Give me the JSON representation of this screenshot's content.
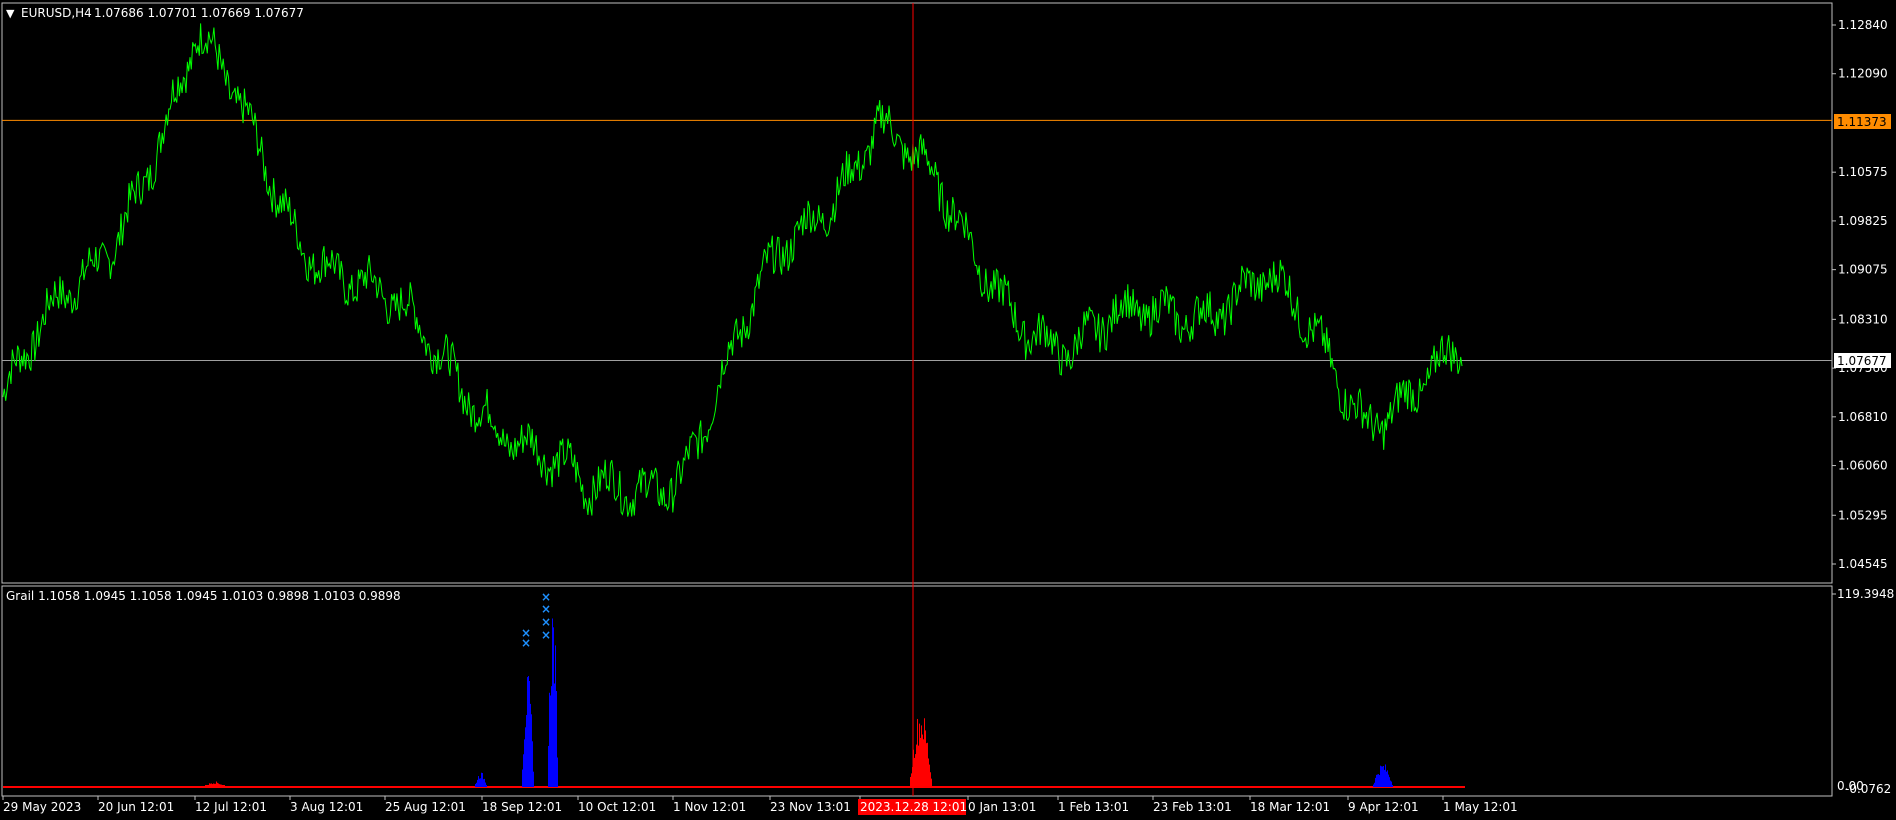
{
  "window": {
    "symbol_label": "EURUSD,H4",
    "ohlc": "1.07686 1.07701 1.07669 1.07677"
  },
  "price_axis": {
    "labels": [
      "1.12840",
      "1.12090",
      "1.10575",
      "1.09825",
      "1.09075",
      "1.08310",
      "1.07560",
      "1.06810",
      "1.06060",
      "1.05295",
      "1.04545"
    ],
    "hline_orange": "1.11373",
    "current_price": "1.07677"
  },
  "indicator": {
    "label": "Grail 1.1058 1.0945 1.1058 1.0945 1.0103 0.9898 1.0103 0.9898",
    "axis_top": "119.3948",
    "axis_bottom_a": "0.00",
    "axis_bottom_b": "-0.0762"
  },
  "time_axis": {
    "labels": [
      "29 May 2023",
      "20 Jun 12:01",
      "12 Jul 12:01",
      "3 Aug 12:01",
      "25 Aug 12:01",
      "18 Sep 12:01",
      "10 Oct 12:01",
      "1 Nov 12:01",
      "23 Nov 13:01",
      "2023.12.28 12:01",
      "0 Jan 13:01",
      "1 Feb 13:01",
      "23 Feb 13:01",
      "18 Mar 12:01",
      "9 Apr 12:01",
      "1 May 12:01"
    ],
    "highlight": "2023.12.28 12:01"
  },
  "colors": {
    "price_line": "#00ff00",
    "orange_line": "#ff8c00",
    "current_line": "#a0a0a0",
    "crosshair": "#ff0000",
    "osc_red": "#ff0000",
    "osc_blue": "#0000ff",
    "marker": "#1e90ff"
  },
  "chart_data": {
    "type": "line",
    "symbol": "EURUSD",
    "timeframe": "H4",
    "ylim": [
      1.0425,
      1.1305
    ],
    "x": [
      "29 May 2023",
      "20 Jun 12:01",
      "12 Jul 12:01",
      "3 Aug 12:01",
      "25 Aug 12:01",
      "18 Sep 12:01",
      "10 Oct 12:01",
      "1 Nov 12:01",
      "23 Nov 13:01",
      "2023.12.28 12:01",
      "0 Jan 13:01",
      "1 Feb 13:01",
      "23 Feb 13:01",
      "18 Mar 12:01",
      "9 Apr 12:01",
      "1 May 12:01"
    ],
    "series": [
      {
        "values": [
          1.0712,
          1.0925,
          1.1255,
          1.0985,
          1.0835,
          1.0705,
          1.0545,
          1.0615,
          1.092,
          1.1145,
          1.0925,
          1.0775,
          1.0855,
          1.088,
          1.0695,
          1.076
        ]
      }
    ],
    "close": 1.07677
  },
  "osc_spikes": [
    {
      "color": "red",
      "v": 0.03
    },
    {
      "color": "blue",
      "v": 0.08
    },
    {
      "color": "blue",
      "v": 0.6
    },
    {
      "color": "blue",
      "v": 1.0
    },
    {
      "color": "red",
      "v": 0.42
    },
    {
      "color": "blue",
      "v": 0.13
    }
  ]
}
